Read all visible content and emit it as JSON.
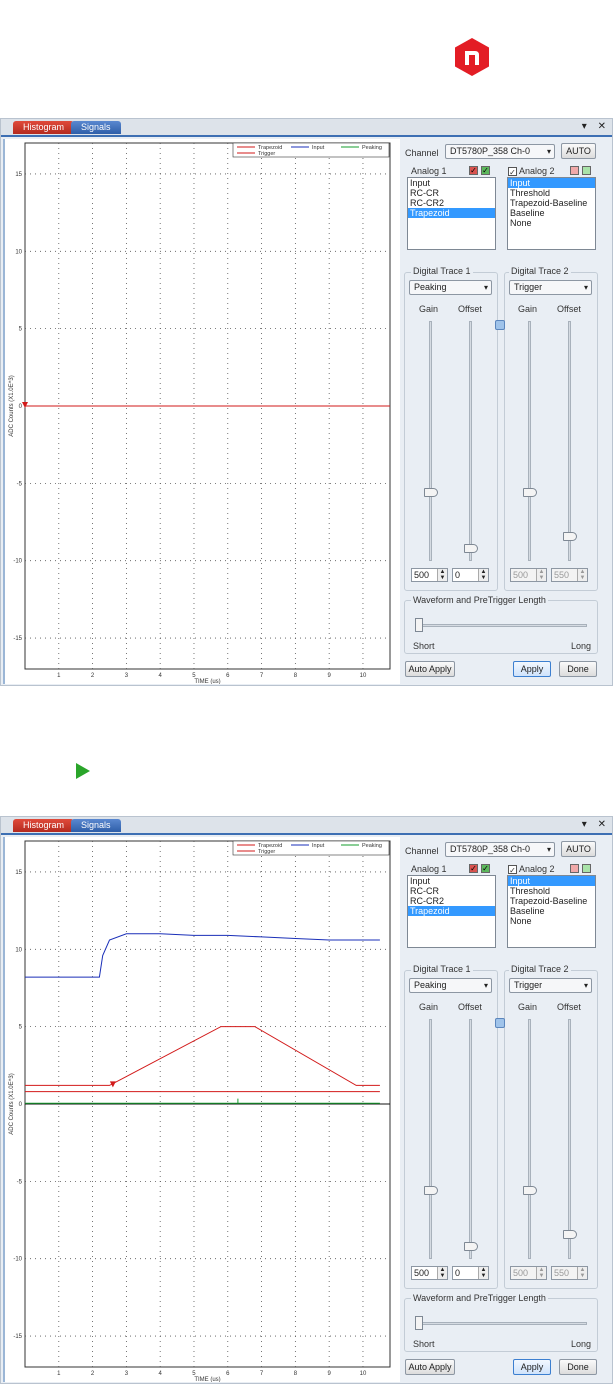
{
  "colors": {
    "brand": "#e31d25",
    "play": "#2aa52a",
    "trapezoid": "#d21a1a",
    "input": "#1a2fb8",
    "peaking": "#169c2e",
    "trigger": "#d21a1a",
    "highlight": "#3399ff"
  },
  "panels": [
    {
      "tabs": [
        "Histogram",
        "Signals"
      ],
      "tab_controls": [
        "▾",
        "✕"
      ],
      "legend": [
        "Trapezoid",
        "Input",
        "Peaking",
        "Trigger"
      ],
      "y_axis_label": "ADC Counts (X1.0E^3)",
      "x_axis_label": "TIME (us)",
      "y_ticks": [
        "15",
        "10",
        "5",
        "0",
        "-5",
        "-10",
        "-15"
      ],
      "x_ticks": [
        "1",
        "2",
        "3",
        "4",
        "5",
        "6",
        "7",
        "8",
        "9",
        "10"
      ],
      "controls": {
        "channel_label": "Channel",
        "channel_value": "DT5780P_358 Ch-0",
        "auto_btn": "AUTO",
        "analog1_label": "Analog 1",
        "analog1_items": [
          "Input",
          "RC-CR",
          "RC-CR2",
          "Trapezoid"
        ],
        "analog1_selected": 3,
        "analog2_label": "Analog 2",
        "analog2_items": [
          "Input",
          "Threshold",
          "Trapezoid-Baseline",
          "Baseline",
          "None"
        ],
        "analog2_selected": 0,
        "dt1_label": "Digital Trace 1",
        "dt1_value": "Peaking",
        "dt2_label": "Digital Trace 2",
        "dt2_value": "Trigger",
        "gain_label": "Gain",
        "offset_label": "Offset",
        "gain1_value": "500",
        "offset1_value": "0",
        "gain2_value": "500",
        "offset2_value": "550",
        "waveform_label": "Waveform and PreTrigger Length",
        "short_label": "Short",
        "long_label": "Long",
        "auto_apply_btn": "Auto Apply",
        "apply_btn": "Apply",
        "done_btn": "Done"
      }
    },
    {
      "tabs": [
        "Histogram",
        "Signals"
      ],
      "tab_controls": [
        "▾",
        "✕"
      ],
      "legend": [
        "Trapezoid",
        "Input",
        "Peaking",
        "Trigger"
      ],
      "y_axis_label": "ADC Counts (X1.0E^3)",
      "x_axis_label": "TIME (us)",
      "y_ticks": [
        "15",
        "10",
        "5",
        "0",
        "-5",
        "-10",
        "-15"
      ],
      "x_ticks": [
        "1",
        "2",
        "3",
        "4",
        "5",
        "6",
        "7",
        "8",
        "9",
        "10"
      ],
      "controls": {
        "channel_label": "Channel",
        "channel_value": "DT5780P_358 Ch-0",
        "auto_btn": "AUTO",
        "analog1_label": "Analog 1",
        "analog1_items": [
          "Input",
          "RC-CR",
          "RC-CR2",
          "Trapezoid"
        ],
        "analog1_selected": 3,
        "analog2_label": "Analog 2",
        "analog2_items": [
          "Input",
          "Threshold",
          "Trapezoid-Baseline",
          "Baseline",
          "None"
        ],
        "analog2_selected": 0,
        "dt1_label": "Digital Trace 1",
        "dt1_value": "Peaking",
        "dt2_label": "Digital Trace 2",
        "dt2_value": "Trigger",
        "gain_label": "Gain",
        "offset_label": "Offset",
        "gain1_value": "500",
        "offset1_value": "0",
        "gain2_value": "500",
        "offset2_value": "550",
        "waveform_label": "Waveform and PreTrigger Length",
        "short_label": "Short",
        "long_label": "Long",
        "auto_apply_btn": "Auto Apply",
        "apply_btn": "Apply",
        "done_btn": "Done"
      }
    }
  ],
  "chart_data": [
    {
      "type": "line",
      "xlabel": "TIME (us)",
      "ylabel": "ADC Counts (X1.0E^3)",
      "xlim": [
        0,
        10.8
      ],
      "ylim": [
        -17,
        17
      ],
      "grid": true,
      "legend_position": "top-right",
      "series": [
        {
          "name": "Trapezoid",
          "x": [
            0,
            10.8
          ],
          "y": [
            0,
            0
          ]
        }
      ],
      "markers": [
        {
          "series": "Trigger",
          "x": 0,
          "y": 0
        }
      ]
    },
    {
      "type": "line",
      "xlabel": "TIME (us)",
      "ylabel": "ADC Counts (X1.0E^3)",
      "xlim": [
        0,
        10.8
      ],
      "ylim": [
        -17,
        17
      ],
      "grid": true,
      "legend_position": "top-right",
      "series": [
        {
          "name": "Input",
          "x": [
            0,
            2.2,
            2.3,
            2.5,
            3.0,
            4.0,
            5.0,
            6.0,
            7.0,
            8.0,
            9.0,
            10.5
          ],
          "y": [
            8.2,
            8.2,
            9.6,
            10.6,
            11.0,
            11.0,
            10.9,
            10.9,
            10.8,
            10.7,
            10.6,
            10.6
          ]
        },
        {
          "name": "Trapezoid",
          "x": [
            0,
            2.5,
            5.8,
            6.8,
            9.8,
            10.5
          ],
          "y": [
            1.2,
            1.2,
            5.0,
            5.0,
            1.2,
            1.2
          ]
        },
        {
          "name": "Trapezoid-Baseline",
          "x": [
            0,
            10.5
          ],
          "y": [
            0.8,
            0.8
          ]
        },
        {
          "name": "Peaking",
          "x": [
            0,
            6.3,
            6.3,
            6.3,
            10.5
          ],
          "y": [
            0.05,
            0.05,
            0.35,
            0.05,
            0.05
          ]
        }
      ],
      "markers": [
        {
          "series": "Trigger",
          "x": 2.6,
          "y": 1.2
        }
      ]
    }
  ]
}
